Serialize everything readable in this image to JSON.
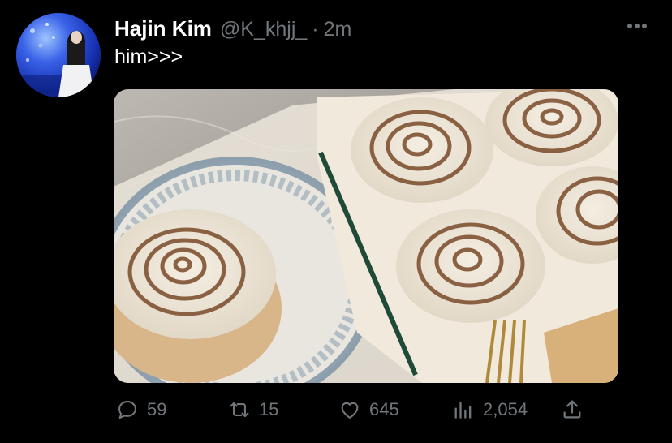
{
  "tweet": {
    "author_name": "Hajin Kim",
    "handle": "@K_khjj_",
    "separator": "·",
    "time": "2m",
    "text": "him>>>"
  },
  "actions": {
    "replies": "59",
    "retweets": "15",
    "likes": "645",
    "views": "2,054"
  },
  "icons": [
    "more-icon",
    "reply-icon",
    "retweet-icon",
    "like-icon",
    "views-icon",
    "share-icon"
  ],
  "colors": {
    "background": "#000000",
    "text": "#e7e9ea",
    "muted": "#71767b",
    "avatar_blue": "#1b3cc7"
  }
}
